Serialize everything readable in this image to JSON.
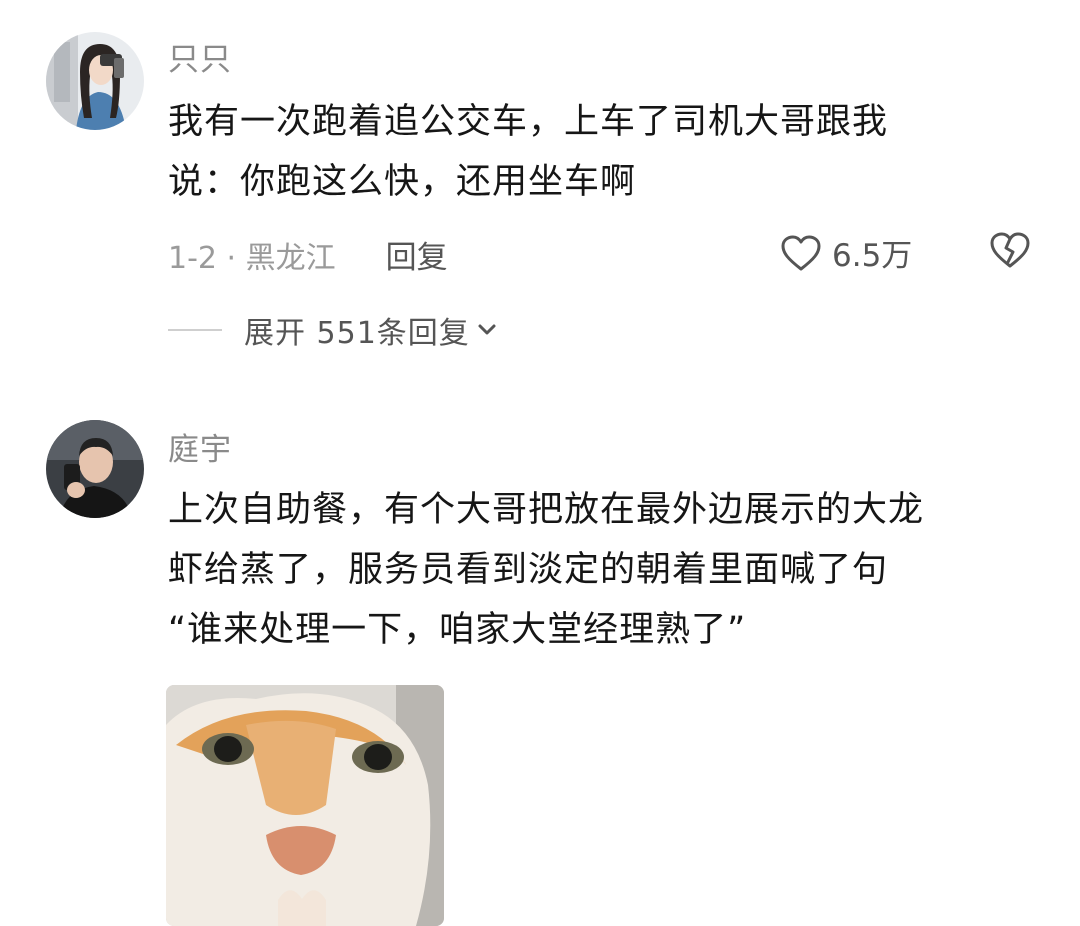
{
  "comments": [
    {
      "username": "只只",
      "lines": [
        "我有一次跑着追公交车，上车了司机大哥跟我",
        "说：你跑这么快，还用坐车啊"
      ],
      "meta": "1-2 · 黑龙江",
      "reply_label": "回复",
      "likes": "6.5万",
      "expand_label": "展开 551条回复"
    },
    {
      "username": "庭宇",
      "lines": [
        "上次自助餐，有个大哥把放在最外边展示的大龙",
        "虾给蒸了，服务员看到淡定的朝着里面喊了句",
        "“谁来处理一下，咱家大堂经理熟了”"
      ]
    }
  ],
  "icons": {
    "like": "heart-icon",
    "dislike": "broken-heart-icon",
    "expand": "chevron-down-icon"
  },
  "colors": {
    "text": "#161616",
    "meta": "#9a9a9a",
    "username": "#8a8a8a"
  }
}
